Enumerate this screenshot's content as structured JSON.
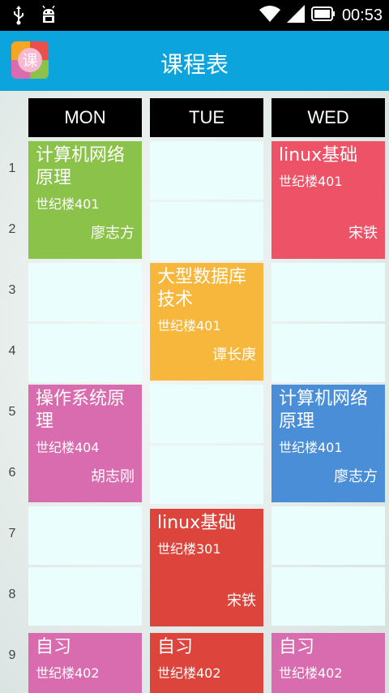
{
  "status_bar": {
    "time": "00:53",
    "icons": [
      "usb-icon",
      "android-debug-icon",
      "wifi-icon",
      "signal-icon",
      "battery-icon"
    ]
  },
  "app_bar": {
    "logo_char": "课",
    "title": "课程表"
  },
  "days": [
    "MON",
    "TUE",
    "WED"
  ],
  "periods": [
    "1",
    "2",
    "3",
    "4",
    "5",
    "6",
    "7",
    "8",
    "9"
  ],
  "courses": {
    "mon_1": {
      "name": "计算机网络原理",
      "room": "世纪楼401",
      "teacher": "廖志方",
      "color": "#8ac24a"
    },
    "mon_5": {
      "name": "操作系统原理",
      "room": "世纪楼404",
      "teacher": "胡志刚",
      "color": "#d86cae"
    },
    "mon_9": {
      "name": "自习",
      "room": "世纪楼402",
      "teacher": "",
      "color": "#d86cae"
    },
    "tue_3": {
      "name": "大型数据库技术",
      "room": "世纪楼401",
      "teacher": "谭长庚",
      "color": "#f6b73c"
    },
    "tue_7": {
      "name": "linux基础",
      "room": "世纪楼301",
      "teacher": "宋铁",
      "color": "#dc443c"
    },
    "tue_9": {
      "name": "自习",
      "room": "世纪楼402",
      "teacher": "",
      "color": "#dc443c"
    },
    "wed_1": {
      "name": "linux基础",
      "room": "世纪楼401",
      "teacher": "宋铁",
      "color": "#ee5266"
    },
    "wed_5": {
      "name": "计算机网络原理",
      "room": "世纪楼401",
      "teacher": "廖志方",
      "color": "#4a8ed8"
    },
    "wed_9": {
      "name": "自习",
      "room": "世纪楼402",
      "teacher": "",
      "color": "#d86cae"
    }
  },
  "colors": {
    "app_bar": "#0ba4dc",
    "empty_cell": "#eafefe",
    "day_header": "#000000"
  }
}
